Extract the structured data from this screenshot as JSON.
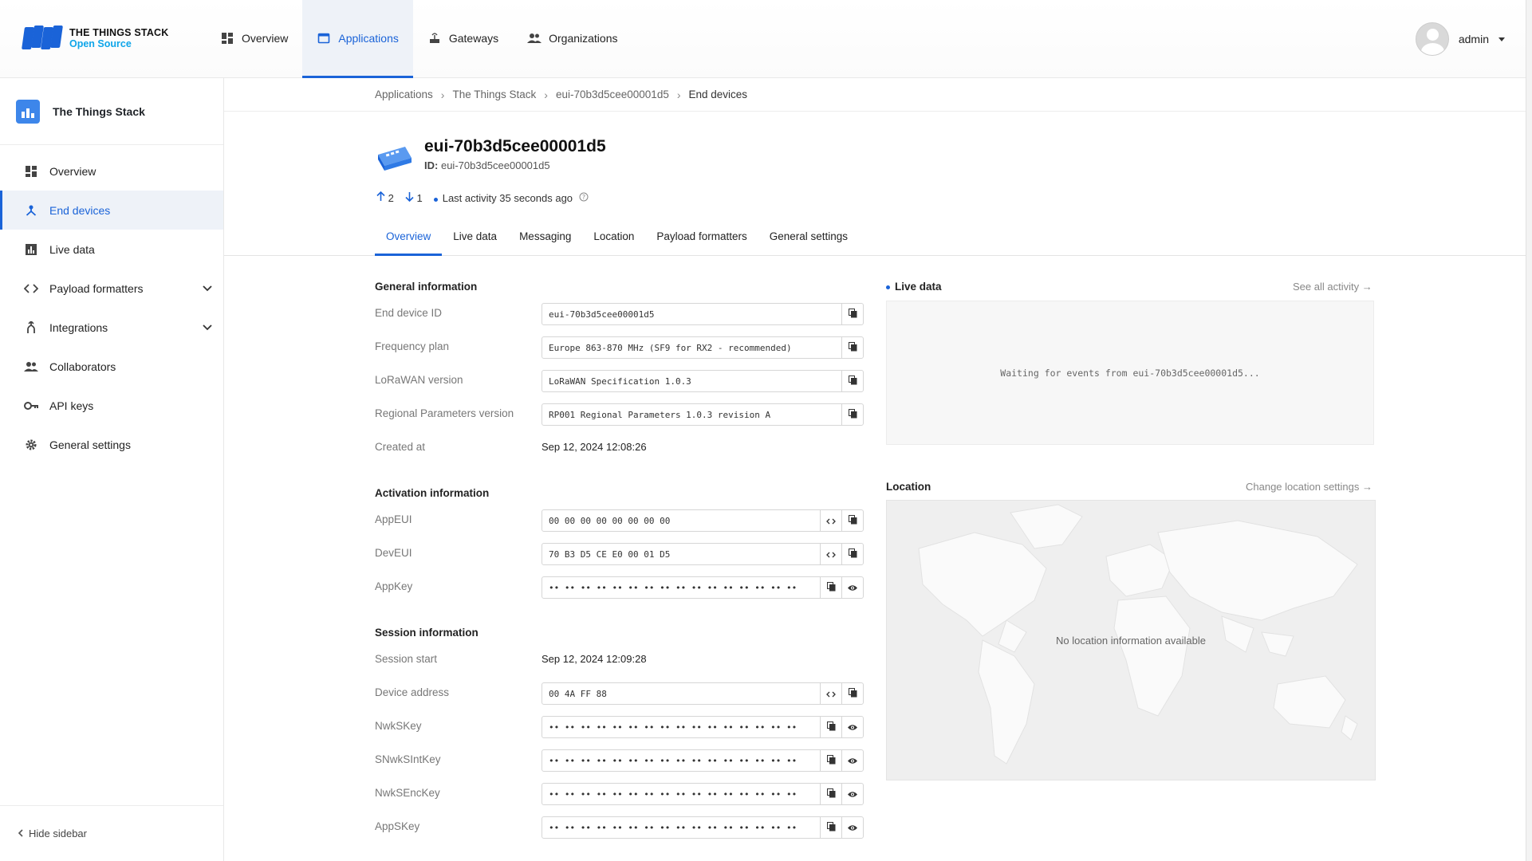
{
  "brand": {
    "line1": "THE THINGS STACK",
    "line2": "Open Source"
  },
  "topnav": [
    {
      "label": "Overview",
      "icon": "dashboard-icon"
    },
    {
      "label": "Applications",
      "icon": "window-icon"
    },
    {
      "label": "Gateways",
      "icon": "gateway-icon"
    },
    {
      "label": "Organizations",
      "icon": "people-icon"
    }
  ],
  "user": {
    "name": "admin"
  },
  "sidebar": {
    "app_name": "The Things Stack",
    "items": [
      {
        "label": "Overview"
      },
      {
        "label": "End devices"
      },
      {
        "label": "Live data"
      },
      {
        "label": "Payload formatters"
      },
      {
        "label": "Integrations"
      },
      {
        "label": "Collaborators"
      },
      {
        "label": "API keys"
      },
      {
        "label": "General settings"
      }
    ],
    "hide": "Hide sidebar"
  },
  "breadcrumb": [
    "Applications",
    "The Things Stack",
    "eui-70b3d5cee00001d5",
    "End devices"
  ],
  "device": {
    "title": "eui-70b3d5cee00001d5",
    "id_label": "ID:",
    "id_value": "eui-70b3d5cee00001d5",
    "uplinks": "2",
    "downlinks": "1",
    "last_activity": "Last activity 35 seconds ago"
  },
  "tabs": [
    "Overview",
    "Live data",
    "Messaging",
    "Location",
    "Payload formatters",
    "General settings"
  ],
  "general": {
    "title": "General information",
    "end_device_id_label": "End device ID",
    "end_device_id": "eui-70b3d5cee00001d5",
    "frequency_plan_label": "Frequency plan",
    "frequency_plan": "Europe 863-870 MHz (SF9 for RX2 - recommended)",
    "lorawan_version_label": "LoRaWAN version",
    "lorawan_version": "LoRaWAN Specification 1.0.3",
    "regional_label": "Regional Parameters version",
    "regional": "RP001 Regional Parameters 1.0.3 revision A",
    "created_label": "Created at",
    "created": "Sep 12, 2024 12:08:26"
  },
  "activation": {
    "title": "Activation information",
    "appeui_label": "AppEUI",
    "appeui": "00 00 00 00 00 00 00 00",
    "deveui_label": "DevEUI",
    "deveui": "70 B3 D5 CE E0 00 01 D5",
    "appkey_label": "AppKey",
    "appkey": "•• •• •• •• •• •• •• •• •• •• •• •• •• •• •• ••"
  },
  "session": {
    "title": "Session information",
    "start_label": "Session start",
    "start": "Sep 12, 2024 12:09:28",
    "devaddr_label": "Device address",
    "devaddr": "00 4A FF 88",
    "nwkskey_label": "NwkSKey",
    "snwksintkey_label": "SNwkSIntKey",
    "nwksenckey_label": "NwkSEncKey",
    "appskey_label": "AppSKey",
    "hidden": "•• •• •• •• •• •• •• •• •• •• •• •• •• •• •• ••"
  },
  "live": {
    "title": "Live data",
    "link": "See all activity →",
    "waiting": "Waiting for events from eui-70b3d5cee00001d5..."
  },
  "location": {
    "title": "Location",
    "link": "Change location settings →",
    "empty": "No location information available"
  },
  "colors": {
    "accent": "#1a63d8",
    "cyan": "#0ea5e9"
  }
}
